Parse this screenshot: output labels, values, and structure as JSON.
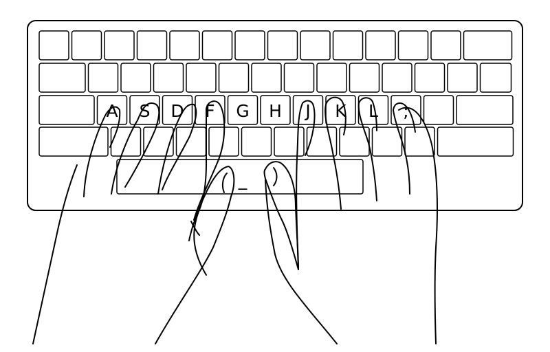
{
  "diagram": {
    "home_row_labels": [
      "A",
      "S",
      "D",
      "F",
      "G",
      "H",
      "J",
      "K",
      "L",
      ";"
    ],
    "spacebar_label": "_",
    "colors": {
      "stroke": "#000000",
      "key_fill": "#ffffff",
      "background": "#ffffff"
    }
  }
}
